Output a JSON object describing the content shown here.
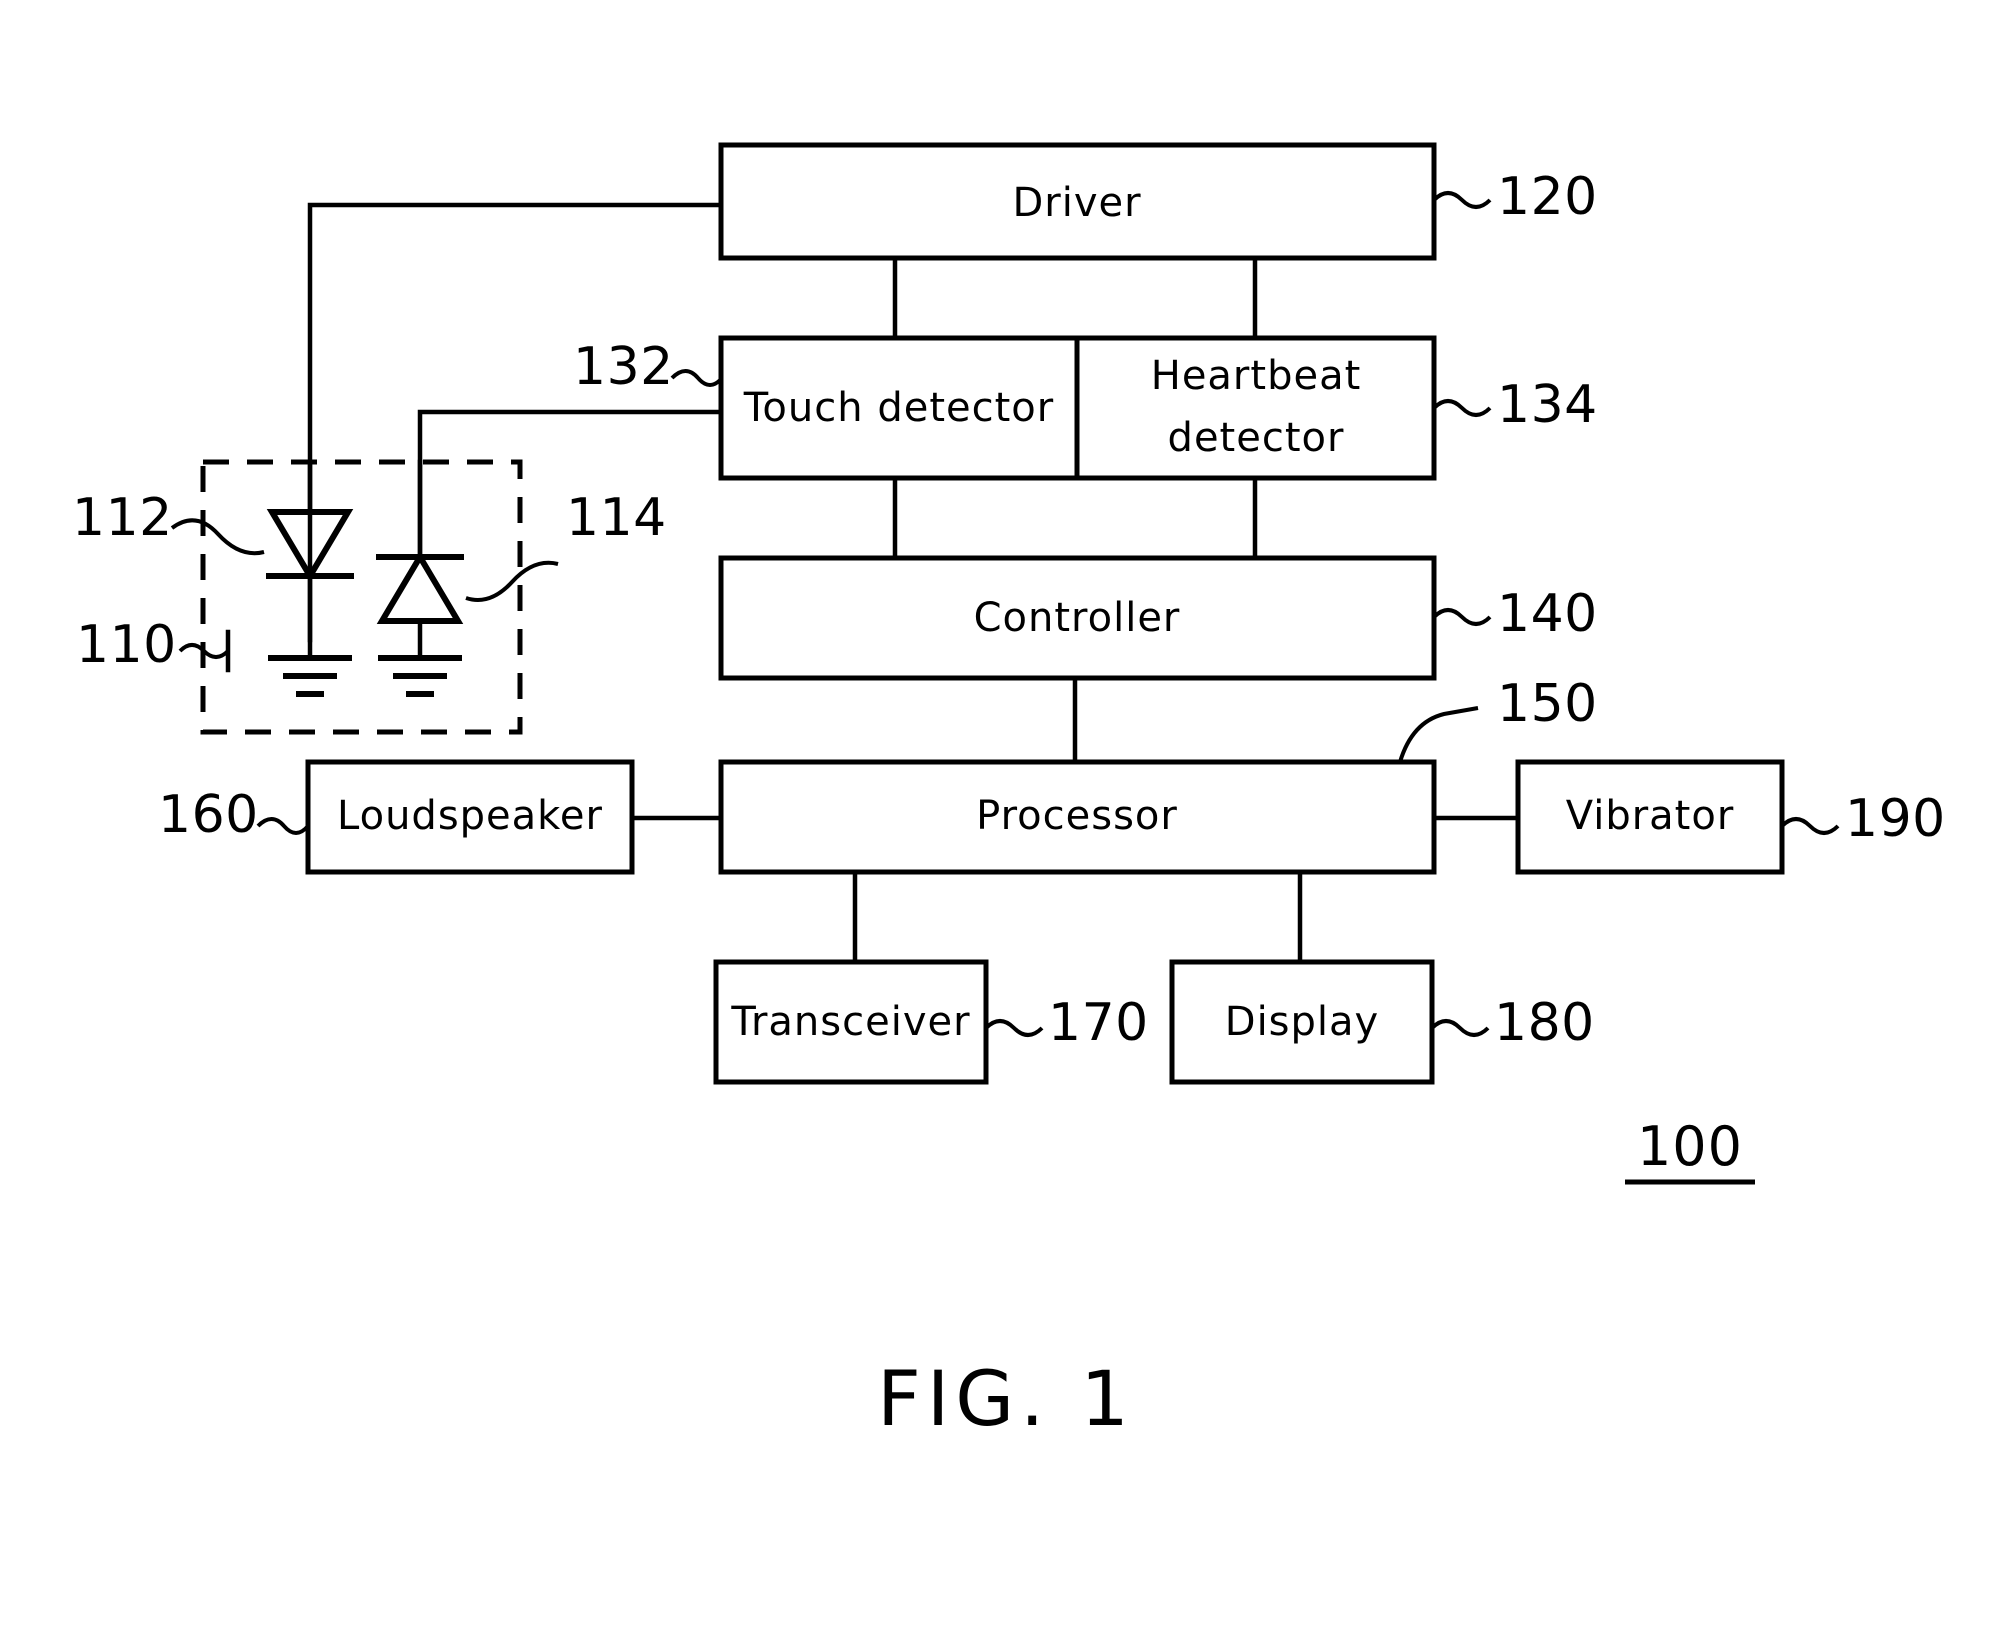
{
  "figure": {
    "caption": "FIG. 1",
    "system_ref": "100"
  },
  "blocks": [
    {
      "id": "driver",
      "label": "Driver",
      "ref": "120"
    },
    {
      "id": "touch-detector",
      "label": "Touch detector",
      "ref": "132"
    },
    {
      "id": "heartbeat-detector",
      "label_line1": "Heartbeat",
      "label_line2": "detector",
      "ref": "134"
    },
    {
      "id": "controller",
      "label": "Controller",
      "ref": "140"
    },
    {
      "id": "processor",
      "label": "Processor",
      "ref": "150"
    },
    {
      "id": "loudspeaker",
      "label": "Loudspeaker",
      "ref": "160"
    },
    {
      "id": "vibrator",
      "label": "Vibrator",
      "ref": "190"
    },
    {
      "id": "transceiver",
      "label": "Transceiver",
      "ref": "170"
    },
    {
      "id": "display",
      "label": "Display",
      "ref": "180"
    }
  ],
  "sensor_module": {
    "ref": "110",
    "components": [
      {
        "id": "led-emitter",
        "ref": "112",
        "type": "diode-down"
      },
      {
        "id": "photo-diode",
        "ref": "114",
        "type": "diode-up"
      }
    ]
  },
  "colors": {
    "stroke": "#000000",
    "background": "#ffffff"
  }
}
